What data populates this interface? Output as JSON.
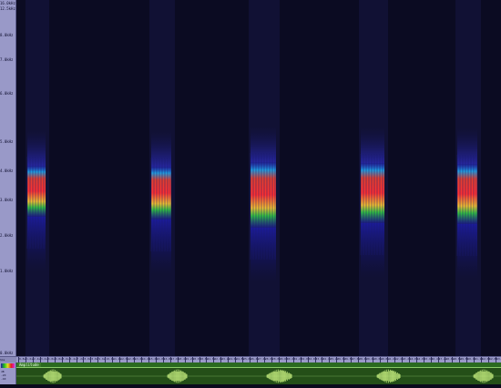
{
  "freq_ruler": {
    "top_labels": [
      "16.0kHz",
      "12.5kHz"
    ],
    "ticks": [
      "8.0kHz",
      "7.0kHz",
      "6.0kHz",
      "5.0kHz",
      "4.0kHz",
      "3.0kHz",
      "2.0kHz",
      "1.0kHz",
      "0.0kHz"
    ]
  },
  "time_ruler": {
    "corner": "hms",
    "labels": [
      "0.8s",
      "1.6s",
      "2.4s",
      "3.2s",
      "4.0s",
      "4.8s",
      "5.6s",
      "6.4s",
      "7.2s",
      "8.0s",
      "8.8s",
      "9.6s",
      "10.4s",
      "11.2s",
      "12.0s",
      "12.8s",
      "13.6s",
      "14.4s",
      "15.2s",
      "16.0s",
      "16.8s",
      "17.6s",
      "18.4s",
      "19.2s",
      "20.0s",
      "20.8s",
      "21.6s",
      "22.4s",
      "23.2s",
      "24.0s",
      "24.8s",
      "25.6s",
      "26.4s",
      "27.2s",
      "28.0s",
      "28.8s",
      "29.6s",
      "30.4s",
      "31.2s",
      "32.0s",
      "32.8s",
      "33.6s",
      "34.4s",
      "35.2s",
      "36.0s",
      "36.8s",
      "37.6s",
      "38.4s",
      "39.2s",
      "40.0s",
      "40.8s",
      "41.6s",
      "42.4s",
      "43.2s",
      "44.0s",
      "44.8s",
      "45.6s",
      "46.4s",
      "47.2s",
      "48.0s",
      "48.8s",
      "49.6s",
      "50.4s",
      "51.2s",
      "52.0s",
      "52.8s",
      "53.6s"
    ]
  },
  "amplitude": {
    "title": "Amplitude",
    "scale_labels": [
      "dB",
      "-20",
      "-40"
    ]
  },
  "colors": {
    "background": "#0b0b22",
    "ruler": "#9999c8",
    "waveform": "#c8f080",
    "waveform_panel": "#244f18"
  },
  "calls": [
    {
      "id": "call-1"
    },
    {
      "id": "call-2"
    },
    {
      "id": "call-3"
    },
    {
      "id": "call-4"
    },
    {
      "id": "call-5"
    }
  ]
}
